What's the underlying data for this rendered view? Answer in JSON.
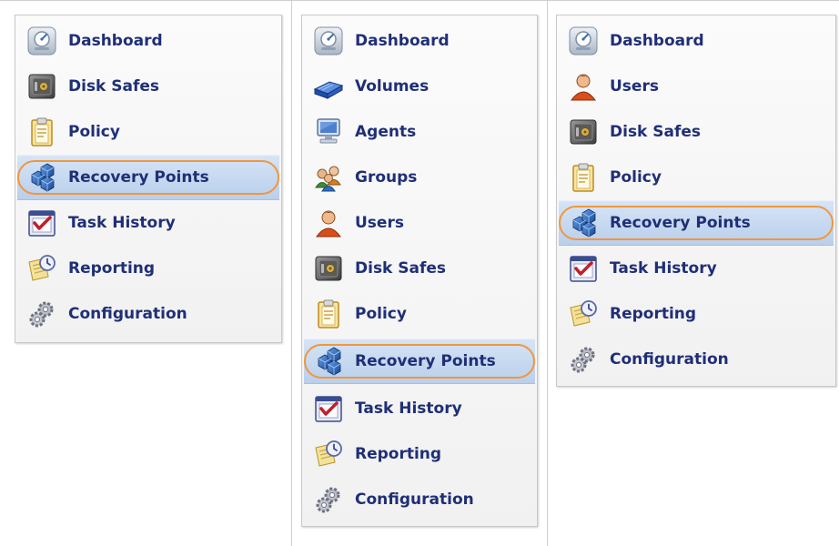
{
  "panels": [
    {
      "items": [
        {
          "label": "Dashboard",
          "icon": "dashboard-icon",
          "active": false
        },
        {
          "label": "Disk Safes",
          "icon": "disk-safe-icon",
          "active": false
        },
        {
          "label": "Policy",
          "icon": "policy-icon",
          "active": false
        },
        {
          "label": "Recovery Points",
          "icon": "recovery-points-icon",
          "active": true
        },
        {
          "label": "Task History",
          "icon": "task-history-icon",
          "active": false
        },
        {
          "label": "Reporting",
          "icon": "reporting-icon",
          "active": false
        },
        {
          "label": "Configuration",
          "icon": "configuration-icon",
          "active": false
        }
      ]
    },
    {
      "items": [
        {
          "label": "Dashboard",
          "icon": "dashboard-icon",
          "active": false
        },
        {
          "label": "Volumes",
          "icon": "volumes-icon",
          "active": false
        },
        {
          "label": "Agents",
          "icon": "agents-icon",
          "active": false
        },
        {
          "label": "Groups",
          "icon": "groups-icon",
          "active": false
        },
        {
          "label": "Users",
          "icon": "users-icon",
          "active": false
        },
        {
          "label": "Disk Safes",
          "icon": "disk-safe-icon",
          "active": false
        },
        {
          "label": "Policy",
          "icon": "policy-icon",
          "active": false
        },
        {
          "label": "Recovery Points",
          "icon": "recovery-points-icon",
          "active": true
        },
        {
          "label": "Task History",
          "icon": "task-history-icon",
          "active": false
        },
        {
          "label": "Reporting",
          "icon": "reporting-icon",
          "active": false
        },
        {
          "label": "Configuration",
          "icon": "configuration-icon",
          "active": false
        }
      ]
    },
    {
      "items": [
        {
          "label": "Dashboard",
          "icon": "dashboard-icon",
          "active": false
        },
        {
          "label": "Users",
          "icon": "users-icon",
          "active": false
        },
        {
          "label": "Disk Safes",
          "icon": "disk-safe-icon",
          "active": false
        },
        {
          "label": "Policy",
          "icon": "policy-icon",
          "active": false
        },
        {
          "label": "Recovery Points",
          "icon": "recovery-points-icon",
          "active": true
        },
        {
          "label": "Task History",
          "icon": "task-history-icon",
          "active": false
        },
        {
          "label": "Reporting",
          "icon": "reporting-icon",
          "active": false
        },
        {
          "label": "Configuration",
          "icon": "configuration-icon",
          "active": false
        }
      ]
    }
  ],
  "colors": {
    "label": "#1f2f77",
    "highlight_ring": "#f0973c",
    "active_background": "#c7d9f0"
  }
}
